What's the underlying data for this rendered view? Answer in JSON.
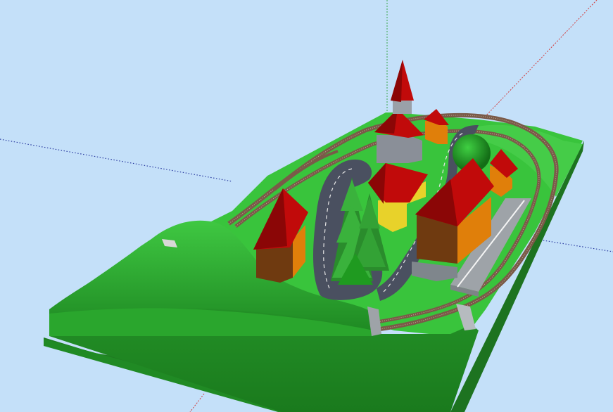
{
  "viewport": {
    "background": "#c4e0f9",
    "axis_colors": {
      "red": "#d23a3a",
      "green": "#3aa64a",
      "blue": "#2a3aa0"
    }
  },
  "scene": {
    "colors": {
      "grass_light": "#39c43c",
      "grass_mid": "#2aa62d",
      "grass_dark": "#1d7c20",
      "board_edge": "#1f7b22",
      "road": "#4a5060",
      "road_line": "#e6e6e6",
      "rail": "#8a6a55",
      "roof": "#c10a0a",
      "roof_dark": "#8b0606",
      "wall_orange": "#e07f0a",
      "wall_brown": "#6f3a10",
      "wall_yellow": "#e8d22a",
      "church_grey": "#8a8f98",
      "platform": "#9ea3a8",
      "tree": "#1f9a20"
    },
    "objects": [
      "layout-board",
      "hill-terrain",
      "railway-track-loop",
      "road-loop",
      "church-with-spire",
      "house-left",
      "house-yellow",
      "house-large",
      "house-small-back",
      "house-right",
      "station-platform",
      "fir-trees",
      "round-tree"
    ]
  }
}
